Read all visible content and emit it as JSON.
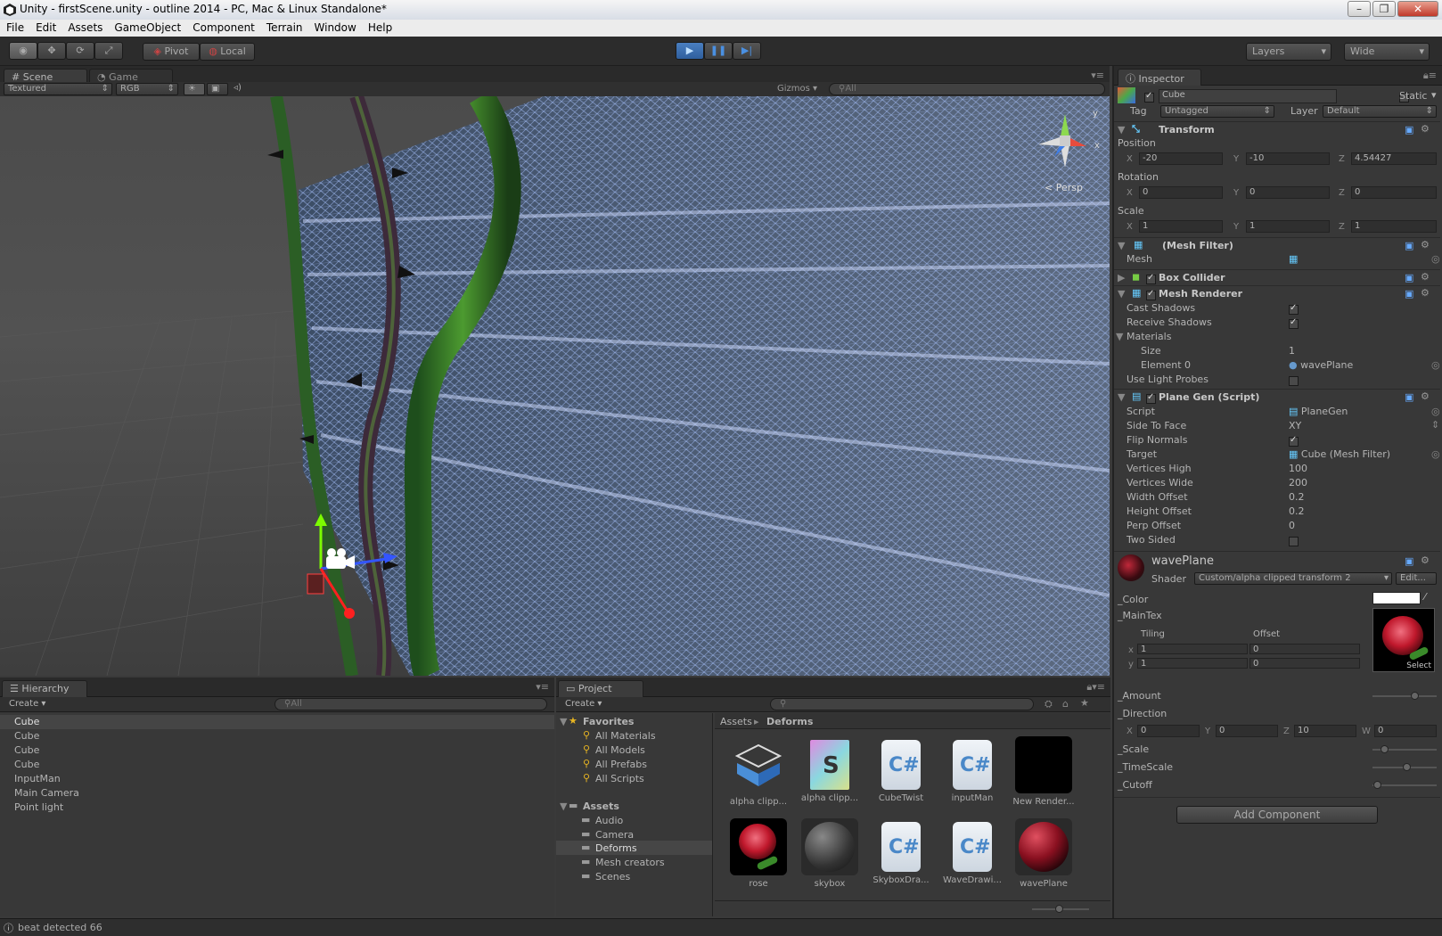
{
  "titlebar": {
    "title": "Unity - firstScene.unity - outline 2014 - PC, Mac & Linux Standalone*"
  },
  "menu": [
    "File",
    "Edit",
    "Assets",
    "GameObject",
    "Component",
    "Terrain",
    "Window",
    "Help"
  ],
  "toolbar": {
    "pivot": "Pivot",
    "local": "Local",
    "layers": "Layers",
    "layout": "Wide"
  },
  "scene": {
    "tab": "Scene",
    "game_tab": "Game",
    "render_mode": "Textured",
    "color_mode": "RGB",
    "gizmos": "Gizmos",
    "search": "All",
    "persp": "Persp",
    "axis_y": "y",
    "axis_x": "x"
  },
  "inspector": {
    "tab": "Inspector",
    "object_name": "Cube",
    "static_label": "Static",
    "tag_label": "Tag",
    "tag_value": "Untagged",
    "layer_label": "Layer",
    "layer_value": "Default",
    "transform": {
      "title": "Transform",
      "position_label": "Position",
      "rotation_label": "Rotation",
      "scale_label": "Scale",
      "px": "-20",
      "py": "-10",
      "pz": "4.54427",
      "rx": "0",
      "ry": "0",
      "rz": "0",
      "sx": "1",
      "sy": "1",
      "sz": "1"
    },
    "axes": {
      "x": "X",
      "y": "Y",
      "z": "Z",
      "w": "W"
    },
    "mesh_filter": {
      "title": "(Mesh Filter)",
      "mesh_label": "Mesh"
    },
    "box_collider": {
      "title": "Box Collider"
    },
    "mesh_renderer": {
      "title": "Mesh Renderer",
      "cast_shadows": "Cast Shadows",
      "receive_shadows": "Receive Shadows",
      "materials": "Materials",
      "size_label": "Size",
      "size_value": "1",
      "element0_label": "Element 0",
      "element0_value": "wavePlane",
      "use_light_probes": "Use Light Probes"
    },
    "plane_gen": {
      "title": "Plane Gen (Script)",
      "rows": [
        {
          "label": "Script",
          "value": "PlaneGen"
        },
        {
          "label": "Side To Face",
          "value": "XY"
        },
        {
          "label": "Flip Normals",
          "value": ""
        },
        {
          "label": "Target",
          "value": "Cube (Mesh Filter)"
        },
        {
          "label": "Vertices High",
          "value": "100"
        },
        {
          "label": "Vertices Wide",
          "value": "200"
        },
        {
          "label": "Width Offset",
          "value": "0.2"
        },
        {
          "label": "Height Offset",
          "value": "0.2"
        },
        {
          "label": "Perp Offset",
          "value": "0"
        },
        {
          "label": "Two Sided",
          "value": ""
        }
      ]
    },
    "material": {
      "name": "wavePlane",
      "shader_label": "Shader",
      "shader_value": "Custom/alpha clipped transform 2",
      "edit": "Edit...",
      "color_label": "_Color",
      "maintex_label": "_MainTex",
      "tiling": "Tiling",
      "offset": "Offset",
      "tile_x": "1",
      "tile_y": "1",
      "off_x": "0",
      "off_y": "0",
      "axis_x": "x",
      "axis_y": "y",
      "select": "Select",
      "amount": "_Amount",
      "direction": "_Direction",
      "dx": "0",
      "dy": "0",
      "dz": "10",
      "dw": "0",
      "scale": "_Scale",
      "timescale": "_TimeScale",
      "cutoff": "_Cutoff",
      "amount_level": 0.7,
      "scale_level": 0.15,
      "timescale_level": 0.55,
      "cutoff_level": 0.02
    },
    "add_component": "Add Component"
  },
  "hierarchy": {
    "tab": "Hierarchy",
    "create": "Create",
    "search": "All",
    "items": [
      "Cube",
      "Cube",
      "Cube",
      "Cube",
      "InputMan",
      "Main Camera",
      "Point light"
    ]
  },
  "project": {
    "tab": "Project",
    "create": "Create",
    "favorites": "Favorites",
    "fav_items": [
      "All Materials",
      "All Models",
      "All Prefabs",
      "All Scripts"
    ],
    "assets": "Assets",
    "folders": [
      "Audio",
      "Camera",
      "Deforms",
      "Mesh creators",
      "Scenes"
    ],
    "breadcrumb_root": "Assets",
    "breadcrumb_current": "Deforms",
    "items": [
      {
        "name": "alpha clipp...",
        "kind": "shader"
      },
      {
        "name": "alpha clipp...",
        "kind": "surface"
      },
      {
        "name": "CubeTwist",
        "kind": "cs"
      },
      {
        "name": "inputMan",
        "kind": "cs"
      },
      {
        "name": "New Render...",
        "kind": "black"
      },
      {
        "name": "rose",
        "kind": "rose"
      },
      {
        "name": "skybox",
        "kind": "sphere"
      },
      {
        "name": "SkyboxDra...",
        "kind": "cs"
      },
      {
        "name": "WaveDrawi...",
        "kind": "cs"
      },
      {
        "name": "wavePlane",
        "kind": "roseball"
      }
    ],
    "cs_glyph": "C#",
    "shader_glyph": "S"
  },
  "status": {
    "message": "beat detected 66"
  },
  "colors": {
    "accent": "#3d6fb3",
    "mesh": "#8fb3ff",
    "stem": "#3f8a2a",
    "bg": "#383838"
  }
}
